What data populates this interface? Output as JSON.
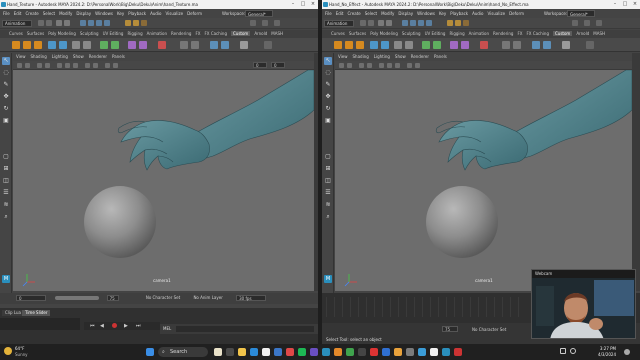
{
  "left_window": {
    "title": "Hand_Texture - Autodesk MAYA 2024.2: D:\\PersonalWork\\Big\\Deku\\Deku\\Anim\\hand_Texture.ma",
    "menus": [
      "File",
      "Edit",
      "Create",
      "Select",
      "Modify",
      "Display",
      "Windows",
      "Key",
      "Playback",
      "Audio",
      "Visualize",
      "Deform"
    ],
    "workspace_label": "Workspace:",
    "workspace_value": "General*",
    "mode": "Animation",
    "shelf_tabs": [
      "Curves",
      "Surfaces",
      "Poly Modeling",
      "Sculpting",
      "UV Editing",
      "Rigging",
      "Animation",
      "Rendering",
      "FX",
      "FX Caching",
      "Custom",
      "Arnold",
      "MASH"
    ],
    "active_shelf_tab": "Custom",
    "panel_menus": [
      "View",
      "Shading",
      "Lighting",
      "Show",
      "Renderer",
      "Panels"
    ],
    "camera_label": "camera1",
    "playback_value": "0",
    "end_frame": "75",
    "character_set": "No Character Set",
    "anim_layer": "No Anim Layer",
    "fps": "30 fps",
    "lower_tabs": [
      "Clip Lua",
      "Time Slider"
    ],
    "mel_label": "MEL"
  },
  "right_window": {
    "title": "Hand_No_Effect - Autodesk MAYA 2024.2: D:\\PersonalWork\\Big\\Deku\\Deku\\Anim\\hand_No_Effect.ma",
    "menus": [
      "File",
      "Edit",
      "Create",
      "Select",
      "Modify",
      "Display",
      "Windows",
      "Key",
      "Playback",
      "Audio",
      "Visualize",
      "Deform"
    ],
    "workspace_label": "Workspace:",
    "workspace_value": "General*",
    "mode": "Animation",
    "shelf_tabs": [
      "Curves",
      "Surfaces",
      "Poly Modeling",
      "Sculpting",
      "UV Editing",
      "Rigging",
      "Animation",
      "Rendering",
      "FX",
      "FX Caching",
      "Custom",
      "Arnold",
      "MASH"
    ],
    "active_shelf_tab": "Custom",
    "panel_menus": [
      "View",
      "Shading",
      "Lighting",
      "Show",
      "Renderer",
      "Panels"
    ],
    "camera_label": "camera1",
    "end_frame": "75",
    "character_set": "No Character Set",
    "mel_label": "MEL",
    "status_message": "Select Tool: select an object"
  },
  "webcam": {
    "title": "Webcam"
  },
  "taskbar": {
    "weather_temp": "64°F",
    "weather_desc": "Sunny",
    "search_placeholder": "Search",
    "clock_time": "3:27 PM",
    "clock_date": "4/3/2024"
  },
  "colors": {
    "viewport_bg": "#6d6d6d",
    "hand": "#4e7d86",
    "sphere": "#8a8a8a",
    "maya_accent": "#2a8fbd"
  }
}
